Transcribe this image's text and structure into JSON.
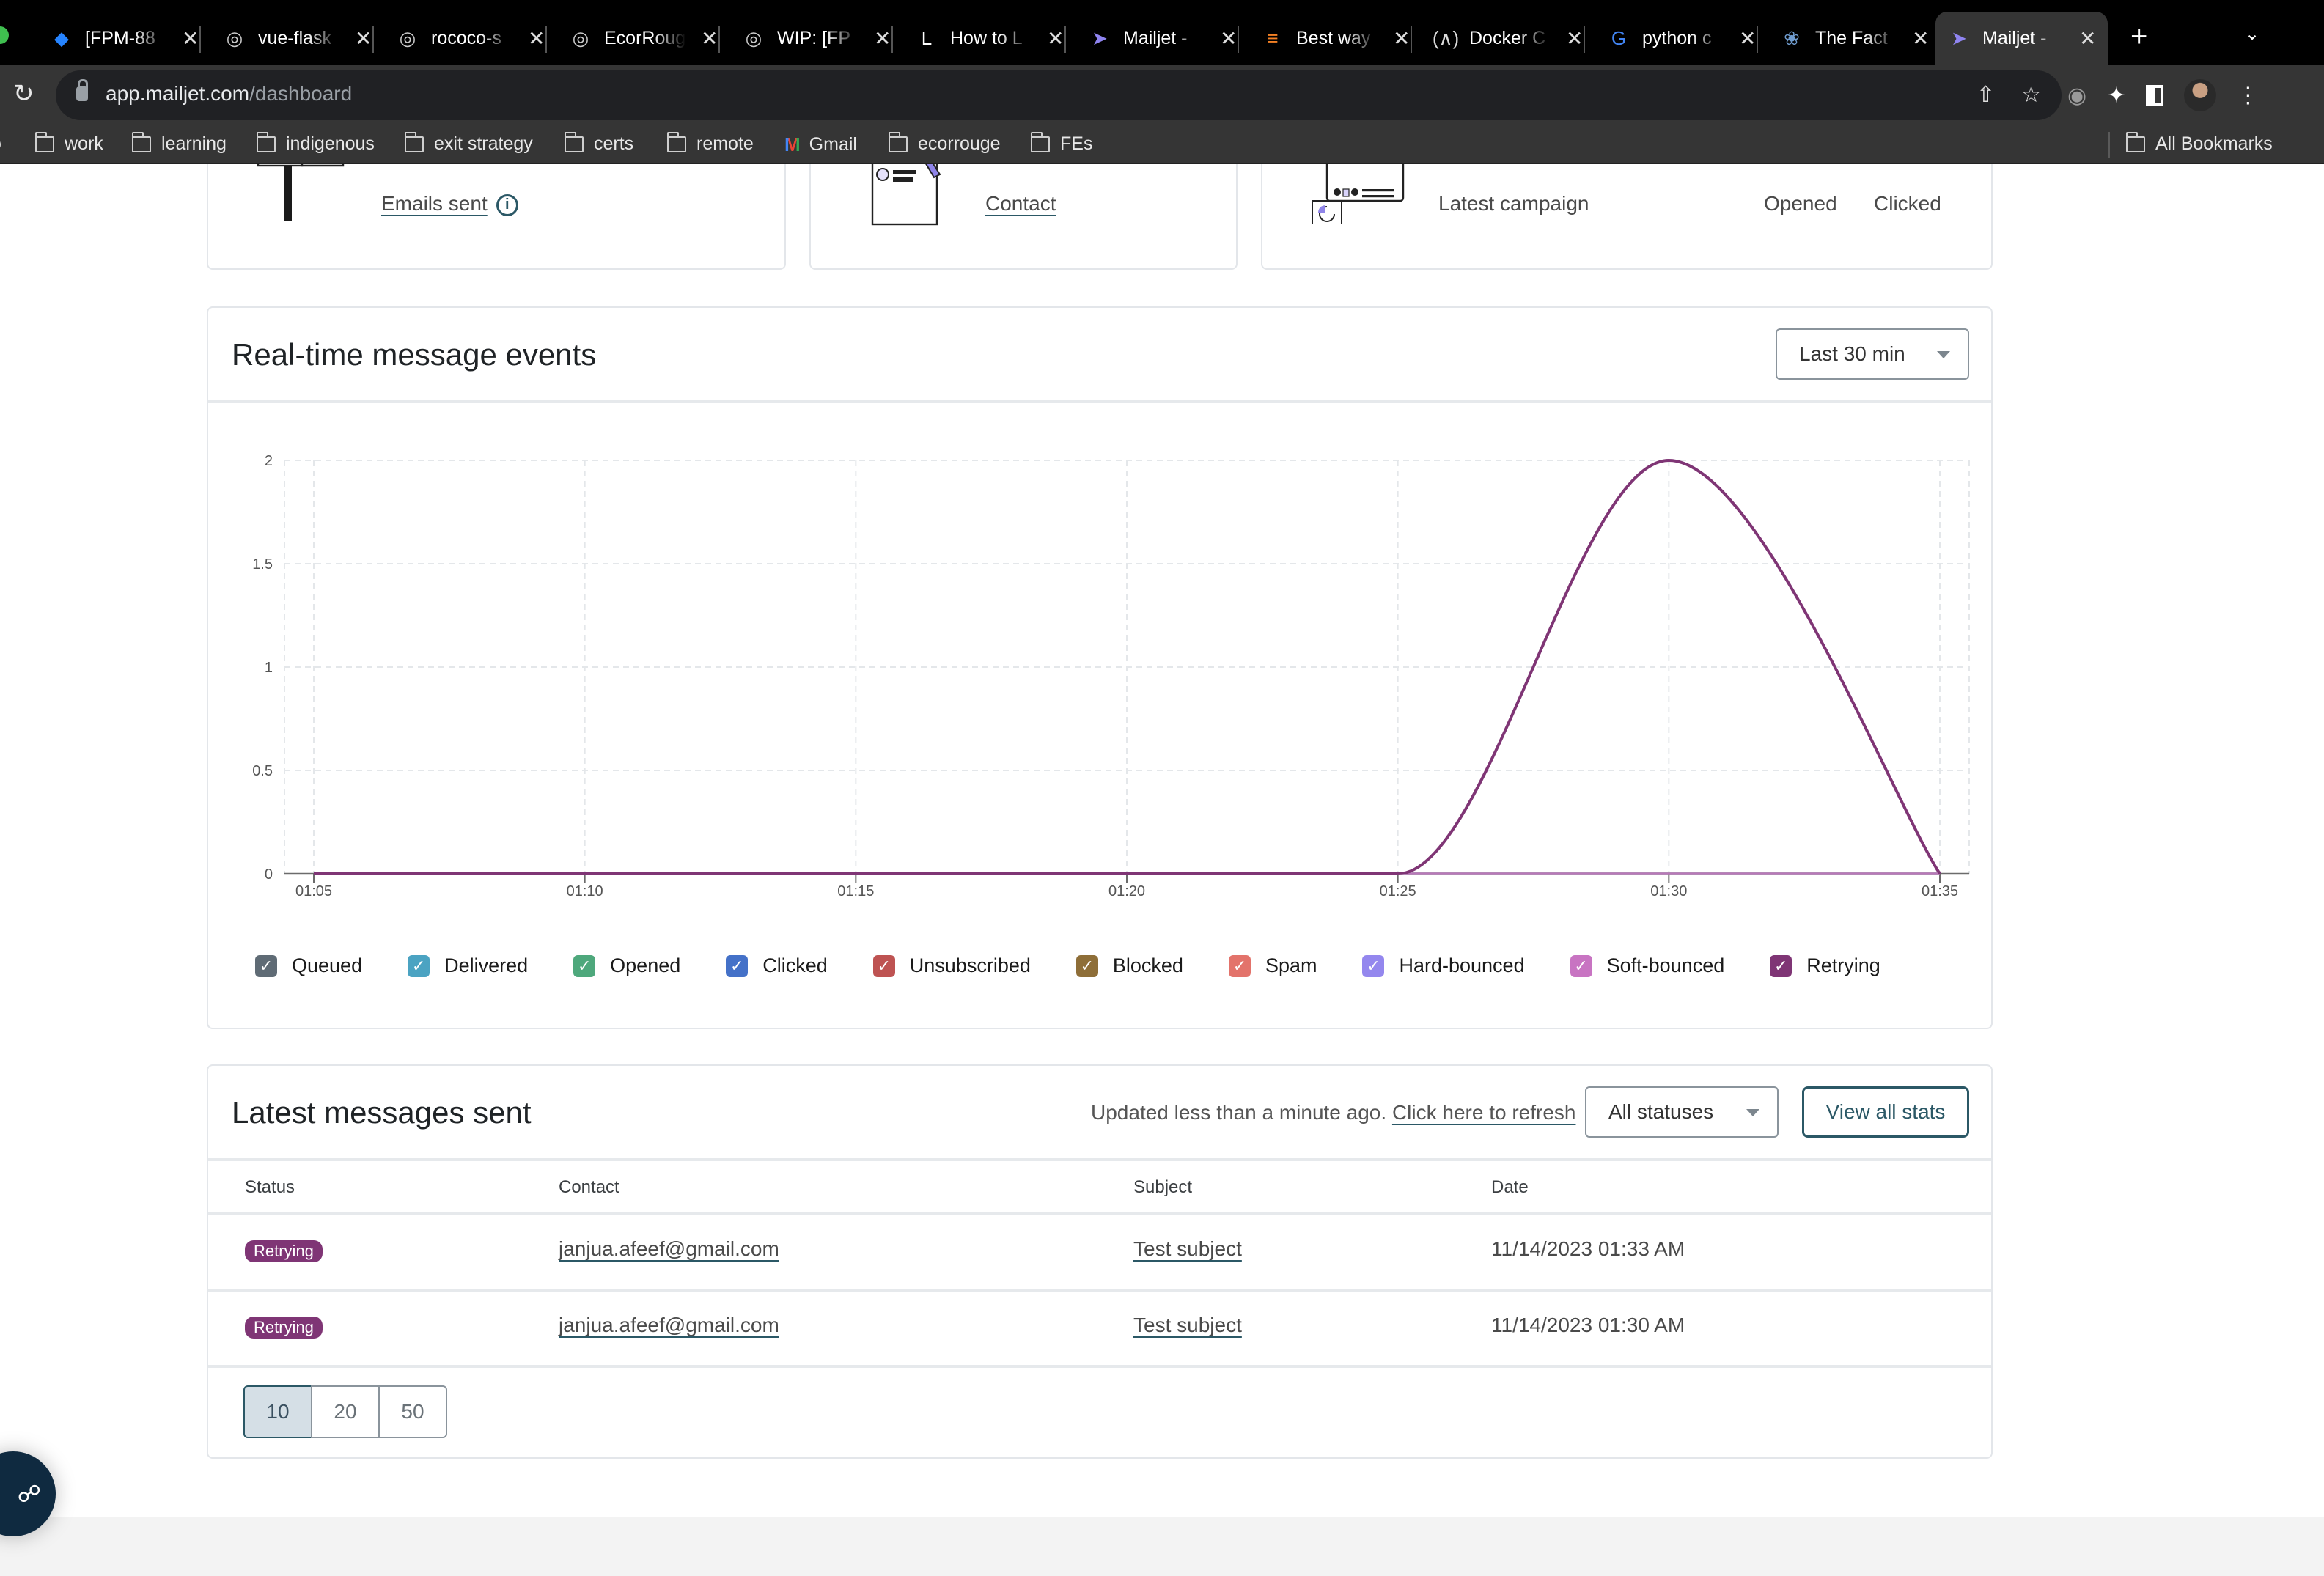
{
  "browser": {
    "tabs": [
      {
        "title": "[FPM-88",
        "icon": "jira-icon",
        "color": "#2684ff"
      },
      {
        "title": "vue-flask",
        "icon": "github-icon",
        "color": "#cccccc"
      },
      {
        "title": "rococo-s",
        "icon": "github-icon",
        "color": "#cccccc"
      },
      {
        "title": "EcorRoug",
        "icon": "github-icon",
        "color": "#cccccc"
      },
      {
        "title": "WIP: [FP",
        "icon": "github-icon",
        "color": "#cccccc"
      },
      {
        "title": "How to L",
        "icon": "letter-l-icon",
        "color": "#ffffff"
      },
      {
        "title": "Mailjet -",
        "icon": "mailjet-icon",
        "color": "#8f84f0"
      },
      {
        "title": "Best way",
        "icon": "stackoverflow-icon",
        "color": "#f48024"
      },
      {
        "title": "Docker C",
        "icon": "freecodecamp-icon",
        "color": "#dddddd"
      },
      {
        "title": "python c",
        "icon": "google-icon",
        "color": "#4285f4"
      },
      {
        "title": "The Fact",
        "icon": "python-icon",
        "color": "#6f9ccf"
      },
      {
        "title": "Mailjet -",
        "icon": "mailjet-icon",
        "color": "#8f84f0",
        "active": true
      }
    ],
    "url_host": "app.mailjet.com",
    "url_path": "/dashboard",
    "bookmarks": [
      {
        "label": "work",
        "icon": "folder-icon"
      },
      {
        "label": "learning",
        "icon": "folder-icon"
      },
      {
        "label": "indigenous",
        "icon": "folder-icon"
      },
      {
        "label": "exit strategy",
        "icon": "folder-icon"
      },
      {
        "label": "certs",
        "icon": "folder-icon"
      },
      {
        "label": "remote",
        "icon": "folder-icon"
      },
      {
        "label": "Gmail",
        "icon": "gmail-icon"
      },
      {
        "label": "ecorrouge",
        "icon": "folder-icon"
      },
      {
        "label": "FEs",
        "icon": "folder-icon"
      }
    ],
    "all_bookmarks": "All Bookmarks"
  },
  "stats": {
    "emails_sent_label": "Emails sent",
    "contact_label": "Contact",
    "latest_campaign_label": "Latest campaign",
    "opened_label": "Opened",
    "clicked_label": "Clicked"
  },
  "realtime": {
    "title": "Real-time message events",
    "range_select": "Last 30 min"
  },
  "chart_data": {
    "type": "line",
    "title": "Real-time message events",
    "x": [
      "01:05",
      "01:10",
      "01:15",
      "01:20",
      "01:25",
      "01:30",
      "01:35"
    ],
    "xlabel": "",
    "ylabel": "",
    "ylim": [
      0,
      2
    ],
    "yticks": [
      0,
      0.5,
      1,
      1.5,
      2
    ],
    "grid": true,
    "legend_position": "bottom",
    "series": [
      {
        "name": "Queued",
        "color": "#5f6b75",
        "values": [
          0,
          0,
          0,
          0,
          0,
          0,
          0
        ]
      },
      {
        "name": "Delivered",
        "color": "#4ba3c2",
        "values": [
          0,
          0,
          0,
          0,
          0,
          0,
          0
        ]
      },
      {
        "name": "Opened",
        "color": "#4ea87c",
        "values": [
          0,
          0,
          0,
          0,
          0,
          0,
          0
        ]
      },
      {
        "name": "Clicked",
        "color": "#4471c8",
        "values": [
          0,
          0,
          0,
          0,
          0,
          0,
          0
        ]
      },
      {
        "name": "Unsubscribed",
        "color": "#be5352",
        "values": [
          0,
          0,
          0,
          0,
          0,
          0,
          0
        ]
      },
      {
        "name": "Blocked",
        "color": "#8e6e38",
        "values": [
          0,
          0,
          0,
          0,
          0,
          0,
          0
        ]
      },
      {
        "name": "Spam",
        "color": "#e3736b",
        "values": [
          0,
          0,
          0,
          0,
          0,
          0,
          0
        ]
      },
      {
        "name": "Hard-bounced",
        "color": "#9487ee",
        "values": [
          0,
          0,
          0,
          0,
          0,
          0,
          0
        ]
      },
      {
        "name": "Soft-bounced",
        "color": "#c874c2",
        "values": [
          0,
          0,
          0,
          0,
          0,
          0,
          0
        ]
      },
      {
        "name": "Retrying",
        "color": "#7f3575",
        "values": [
          0,
          0,
          0,
          0,
          0,
          2,
          0
        ]
      }
    ]
  },
  "latest": {
    "title": "Latest messages sent",
    "updated_text": "Updated less than a minute ago.",
    "refresh_link": "Click here to refresh",
    "status_select": "All statuses",
    "view_all": "View all stats",
    "columns": [
      "Status",
      "Contact",
      "Subject",
      "Date"
    ],
    "rows": [
      {
        "status": "Retrying",
        "contact": "janjua.afeef@gmail.com",
        "subject": "Test subject",
        "date": "11/14/2023 01:33 AM"
      },
      {
        "status": "Retrying",
        "contact": "janjua.afeef@gmail.com",
        "subject": "Test subject",
        "date": "11/14/2023 01:30 AM"
      }
    ],
    "page_sizes": [
      "10",
      "20",
      "50"
    ],
    "active_page_size": "10"
  }
}
